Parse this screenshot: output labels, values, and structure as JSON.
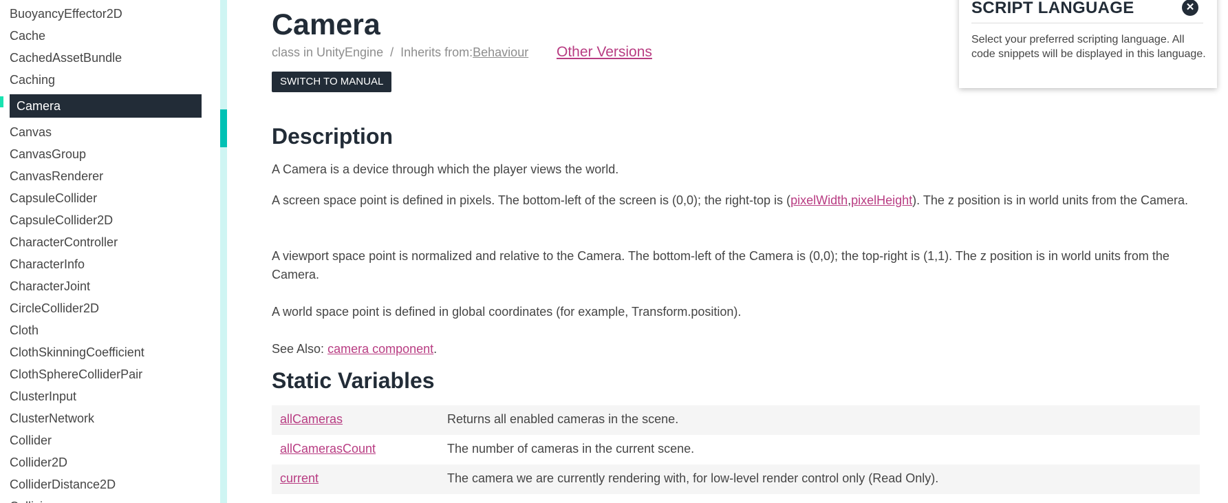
{
  "sidebar": {
    "items": [
      {
        "label": "BuoyancyEffector2D"
      },
      {
        "label": "Cache"
      },
      {
        "label": "CachedAssetBundle"
      },
      {
        "label": "Caching"
      },
      {
        "label": "Camera",
        "active": true
      },
      {
        "label": "Canvas"
      },
      {
        "label": "CanvasGroup"
      },
      {
        "label": "CanvasRenderer"
      },
      {
        "label": "CapsuleCollider"
      },
      {
        "label": "CapsuleCollider2D"
      },
      {
        "label": "CharacterController"
      },
      {
        "label": "CharacterInfo"
      },
      {
        "label": "CharacterJoint"
      },
      {
        "label": "CircleCollider2D"
      },
      {
        "label": "Cloth"
      },
      {
        "label": "ClothSkinningCoefficient"
      },
      {
        "label": "ClothSphereColliderPair"
      },
      {
        "label": "ClusterInput"
      },
      {
        "label": "ClusterNetwork"
      },
      {
        "label": "Collider"
      },
      {
        "label": "Collider2D"
      },
      {
        "label": "ColliderDistance2D"
      },
      {
        "label": "Collision"
      }
    ]
  },
  "page": {
    "title": "Camera",
    "class_in": "class in UnityEngine",
    "separator": "/",
    "inherits_label": "Inherits from:",
    "inherits_link": "Behaviour",
    "other_versions": "Other Versions",
    "switch_button": "SWITCH TO MANUAL"
  },
  "description": {
    "heading": "Description",
    "p1": "A Camera is a device through which the player views the world.",
    "p2_a": "A screen space point is defined in pixels. The bottom-left of the screen is (0,0); the right-top is (",
    "p2_link1": "pixelWidth",
    "p2_comma": ",",
    "p2_link2": "pixelHeight",
    "p2_b": "). The z position is in world units from the Camera.",
    "p3": "A viewport space point is normalized and relative to the Camera. The bottom-left of the Camera is (0,0); the top-right is (1,1). The z position is in world units from the Camera.",
    "p4": "A world space point is defined in global coordinates (for example, Transform.position).",
    "see_also_label": "See Also: ",
    "see_also_link": "camera component",
    "see_also_end": "."
  },
  "static_variables": {
    "heading": "Static Variables",
    "rows": [
      {
        "name": "allCameras",
        "desc": "Returns all enabled cameras in the scene."
      },
      {
        "name": "allCamerasCount",
        "desc": "The number of cameras in the current scene."
      },
      {
        "name": "current",
        "desc": "The camera we are currently rendering with, for low-level render control only (Read Only)."
      }
    ]
  },
  "popup": {
    "title": "SCRIPT LANGUAGE",
    "close_glyph": "✕",
    "body": "Select your preferred scripting language. All code snippets will be displayed in this language."
  },
  "colors": {
    "link": "#b83c82",
    "dark": "#222c37",
    "accent": "#00c1b4"
  }
}
